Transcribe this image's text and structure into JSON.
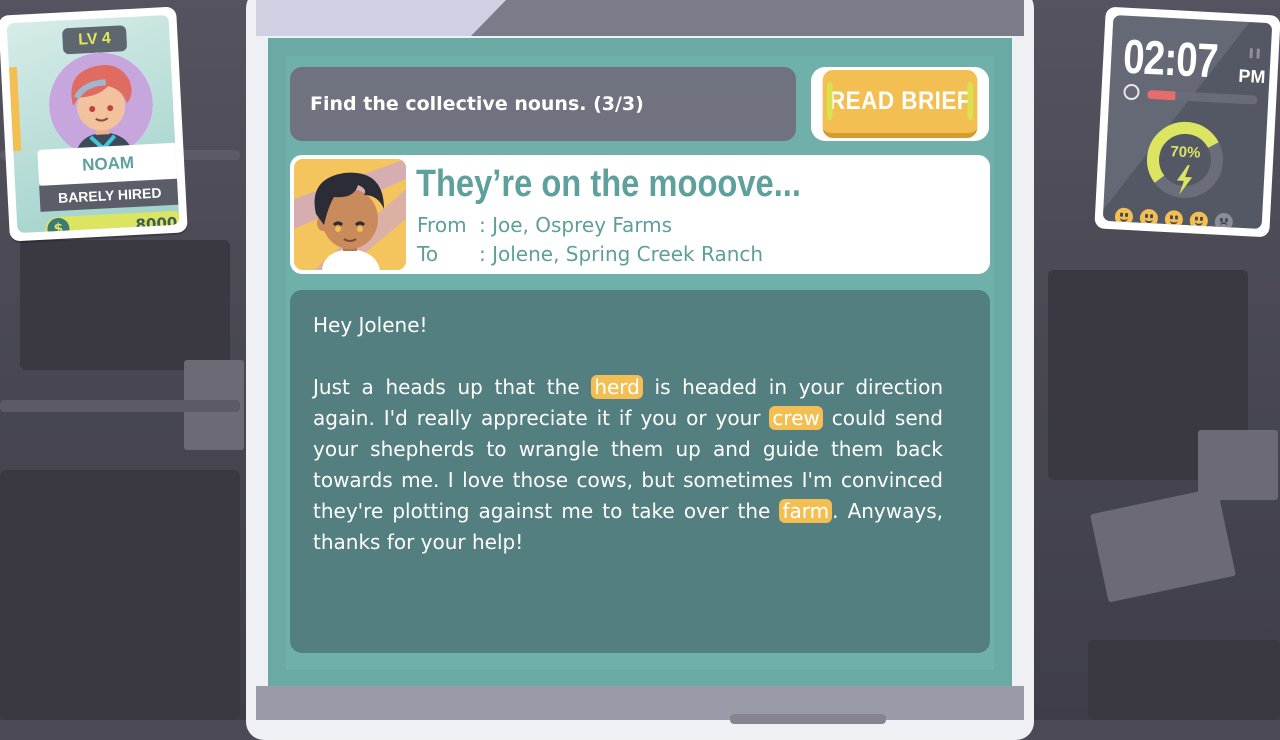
{
  "player": {
    "level": "LV 4",
    "name": "NOAM",
    "rank": "BARELY HIRED",
    "money": "8000",
    "money_icon": "dollar-icon"
  },
  "clock": {
    "time": "02:07",
    "ampm": "PM",
    "day_progress_fraction": 0.25,
    "energy_percent": 70,
    "energy_label": "70%",
    "energy_icon": "lightning-icon",
    "mood_faces": [
      "happy",
      "happy",
      "happy",
      "happy",
      "sad"
    ]
  },
  "task": {
    "instruction": "Find the collective nouns. (3/3)",
    "read_brief_label": "READ BRIEF"
  },
  "email": {
    "subject": "They’re on the mooove...",
    "from_label": "From",
    "from_value": ": Joe, Osprey Farms",
    "to_label": "To",
    "to_value": ": Jolene, Spring Creek Ranch",
    "greeting": "Hey Jolene!",
    "body": {
      "t1": "Just a heads up that the ",
      "w1": "herd",
      "t2": " is headed in your direction again. I'd really appreciate it if you or your ",
      "w2": "crew",
      "t3": " could send your shepherds to wrangle them up and guide them back towards me. I love those cows, but sometimes I'm convinced they're plotting against me to take over the ",
      "w3": "farm",
      "t4": ". Anyways, thanks for your help!"
    }
  },
  "colors": {
    "accent_teal": "#5ea19c",
    "highlight_yellow": "#f3bf52",
    "body_panel": "#537f80",
    "task_panel": "#71727f",
    "energy_green": "#dbe562"
  }
}
